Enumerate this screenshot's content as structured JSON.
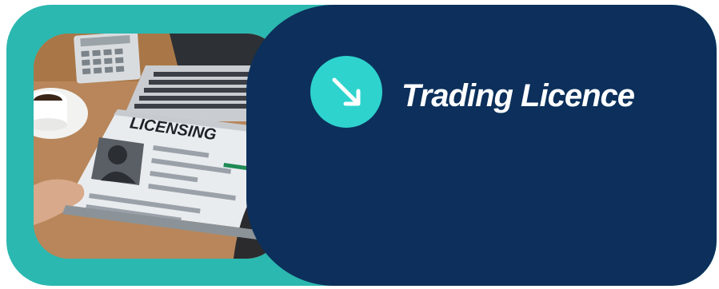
{
  "card": {
    "title": "Trading Licence",
    "badge_icon": "arrow-down-right-icon",
    "colors": {
      "outer": "#2bb8b0",
      "panel": "#0c305b",
      "badge": "#2ed3cd",
      "title": "#ffffff"
    }
  },
  "photo": {
    "document_heading": "LICENSING",
    "objects": [
      "calculator-icon",
      "laptop-icon",
      "coffee-cup-icon",
      "id-photo-icon",
      "pen-icon"
    ]
  }
}
